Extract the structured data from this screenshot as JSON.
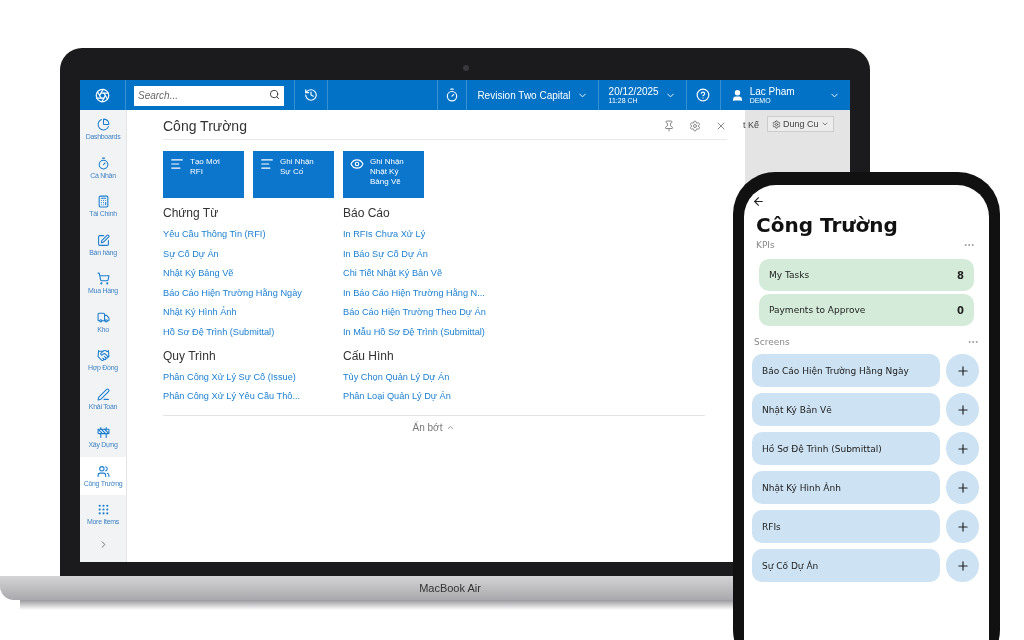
{
  "laptop": {
    "topbar": {
      "search": {
        "placeholder": "Search..."
      },
      "company": "Revision Two Capital",
      "date": "20/12/2025",
      "time": "11:28 CH",
      "user": "Lac Pham",
      "tenant": "DEMO"
    },
    "sidebar": {
      "items": [
        {
          "label": "Dashboards",
          "selected": false
        },
        {
          "label": "Cá Nhân",
          "selected": false
        },
        {
          "label": "Tài Chính",
          "selected": false
        },
        {
          "label": "Bán hàng",
          "selected": false
        },
        {
          "label": "Mua Hàng",
          "selected": false
        },
        {
          "label": "Kho",
          "selected": false
        },
        {
          "label": "Hợp Đồng",
          "selected": false
        },
        {
          "label": "Khải Toán",
          "selected": false
        },
        {
          "label": "Xây Dựng",
          "selected": false
        },
        {
          "label": "Công Trường",
          "selected": true
        },
        {
          "label": "More Items",
          "selected": false
        }
      ]
    },
    "flyout": {
      "title": "Công Trường",
      "tiles": [
        {
          "lines": [
            "Tạo Mới",
            "RFI"
          ]
        },
        {
          "lines": [
            "Ghi Nhận",
            "Sự Cố"
          ]
        },
        {
          "lines": [
            "Ghi Nhận",
            "Nhật Ký",
            "Bảng Vẽ"
          ]
        }
      ],
      "sections": [
        {
          "heading": "Chứng Từ",
          "links": [
            "Yêu Cầu Thông Tin (RFI)",
            "Sự Cố Dự Án",
            "Nhật Ký Bảng Vẽ",
            "Báo Cáo Hiện Trường Hằng Ngày",
            "Nhật Ký Hình Ảnh",
            "Hồ Sơ Đệ Trình (Submittal)"
          ]
        },
        {
          "heading": "Báo Cáo",
          "links": [
            "In RFIs Chưa Xử Lý",
            "In Báo Sự Cố Dự Án",
            "Chi Tiết Nhật Ký Bản Vẽ",
            "In Báo Cáo Hiện Trường Hằng N...",
            "Báo Cáo Hiện Trường Theo Dự Án",
            "In Mẫu Hồ Sơ Đệ Trình (Submittal)"
          ]
        },
        {
          "heading": "Quy Trình",
          "links": [
            "Phân Công Xử Lý Sự Cố (Issue)",
            "Phân Công Xử Lý Yêu Cầu Thô..."
          ]
        },
        {
          "heading": "Cấu Hình",
          "links": [
            "Tùy Chọn Quản Lý Dự Án",
            "Phân Loại Quản Lý Dự Án"
          ]
        }
      ],
      "collapse": "Ẩn bớt"
    },
    "background": {
      "text": "t Kế",
      "button": "Dung Cu"
    },
    "brand": "MacBook Air"
  },
  "phone": {
    "title": "Công Trường",
    "kpis_label": "KPIs",
    "kpis": [
      {
        "label": "My Tasks",
        "value": "8"
      },
      {
        "label": "Payments to Approve",
        "value": "0"
      }
    ],
    "screens_label": "Screens",
    "screens": [
      "Báo Cáo Hiện Trường Hằng Ngày",
      "Nhật Ký Bản Vẽ",
      "Hồ Sơ Đệ Trình (Submittal)",
      "Nhật Ký Hình Ảnh",
      "RFIs",
      "Sự Cố Dự Án"
    ]
  }
}
